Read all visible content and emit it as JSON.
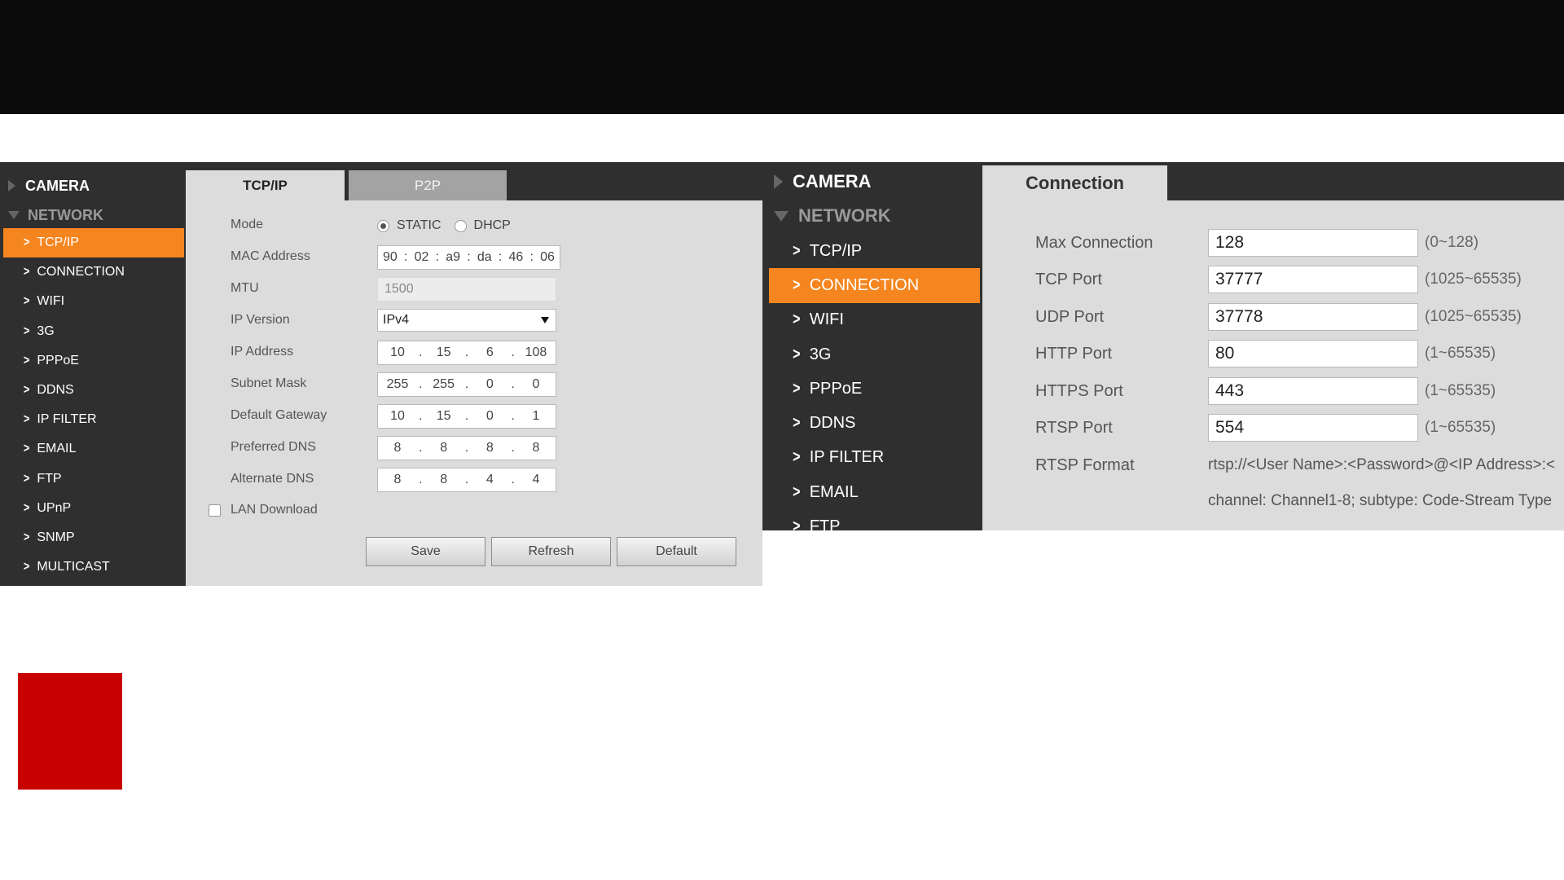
{
  "screen1": {
    "sidebar": {
      "camera": "CAMERA",
      "network": "NETWORK",
      "items": [
        "TCP/IP",
        "CONNECTION",
        "WIFI",
        "3G",
        "PPPoE",
        "DDNS",
        "IP FILTER",
        "EMAIL",
        "FTP",
        "UPnP",
        "SNMP",
        "MULTICAST"
      ],
      "active_item": "TCP/IP"
    },
    "tabs": [
      "TCP/IP",
      "P2P"
    ],
    "active_tab": "TCP/IP",
    "form": {
      "mode_label": "Mode",
      "mode_options": [
        "STATIC",
        "DHCP"
      ],
      "mode_selected": "STATIC",
      "mac_label": "MAC Address",
      "mac": [
        "90",
        "02",
        "a9",
        "da",
        "46",
        "06"
      ],
      "mtu_label": "MTU",
      "mtu": "1500",
      "ipversion_label": "IP Version",
      "ipversion": "IPv4",
      "ip_label": "IP Address",
      "ip": [
        "10",
        "15",
        "6",
        "108"
      ],
      "subnet_label": "Subnet Mask",
      "subnet": [
        "255",
        "255",
        "0",
        "0"
      ],
      "gateway_label": "Default Gateway",
      "gateway": [
        "10",
        "15",
        "0",
        "1"
      ],
      "dns1_label": "Preferred DNS",
      "dns1": [
        "8",
        "8",
        "8",
        "8"
      ],
      "dns2_label": "Alternate DNS",
      "dns2": [
        "8",
        "8",
        "4",
        "4"
      ],
      "lan_download_label": "LAN Download",
      "lan_download_checked": false
    },
    "buttons": {
      "save": "Save",
      "refresh": "Refresh",
      "default": "Default"
    }
  },
  "screen2": {
    "sidebar": {
      "camera": "CAMERA",
      "network": "NETWORK",
      "items": [
        "TCP/IP",
        "CONNECTION",
        "WIFI",
        "3G",
        "PPPoE",
        "DDNS",
        "IP FILTER",
        "EMAIL",
        "FTP"
      ],
      "active_item": "CONNECTION"
    },
    "tab": "Connection",
    "fields": [
      {
        "label": "Max Connection",
        "value": "128",
        "range": "(0~128)"
      },
      {
        "label": "TCP Port",
        "value": "37777",
        "range": "(1025~65535)"
      },
      {
        "label": "UDP Port",
        "value": "37778",
        "range": "(1025~65535)"
      },
      {
        "label": "HTTP Port",
        "value": "80",
        "range": "(1~65535)"
      },
      {
        "label": "HTTPS Port",
        "value": "443",
        "range": "(1~65535)"
      },
      {
        "label": "RTSP Port",
        "value": "554",
        "range": "(1~65535)"
      }
    ],
    "rtsp_format_label": "RTSP Format",
    "rtsp_format_line1": "rtsp://<User Name>:<Password>@<IP Address>:<",
    "rtsp_format_line2": "channel: Channel1-8; subtype: Code-Stream Type"
  },
  "colors": {
    "top_bar": "#0b0b0b",
    "sidebar": "#2f2f2f",
    "active": "#f5851f",
    "panel": "#dcdcdc",
    "red_block": "#c80000"
  }
}
